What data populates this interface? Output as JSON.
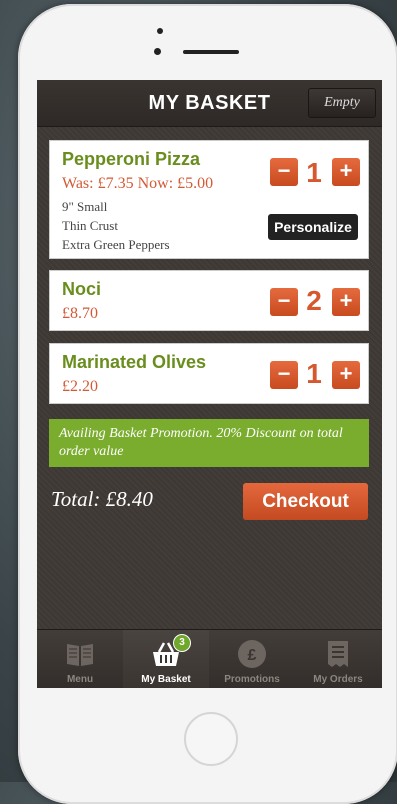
{
  "header": {
    "title": "MY BASKET",
    "empty_label": "Empty"
  },
  "items": [
    {
      "name": "Pepperoni Pizza",
      "price": "Was: £7.35 Now: £5.00",
      "details": [
        "9\" Small",
        "Thin Crust",
        "Extra Green Peppers"
      ],
      "qty": "1",
      "personalize_label": "Personalize"
    },
    {
      "name": "Noci",
      "price": "£8.70",
      "qty": "2"
    },
    {
      "name": "Marinated Olives",
      "price": "£2.20",
      "qty": "1"
    }
  ],
  "promotion": "Availing Basket Promotion. 20% Discount on total order value",
  "total": "Total: £8.40",
  "checkout_label": "Checkout",
  "tabs": [
    {
      "label": "Menu",
      "icon": "book-icon"
    },
    {
      "label": "My Basket",
      "icon": "basket-icon",
      "badge": "3"
    },
    {
      "label": "Promotions",
      "icon": "pound-seal-icon"
    },
    {
      "label": "My Orders",
      "icon": "receipt-icon"
    }
  ],
  "colors": {
    "accent": "#d5582f",
    "green": "#6a8e1e",
    "promo_bg": "#7aac2e"
  }
}
